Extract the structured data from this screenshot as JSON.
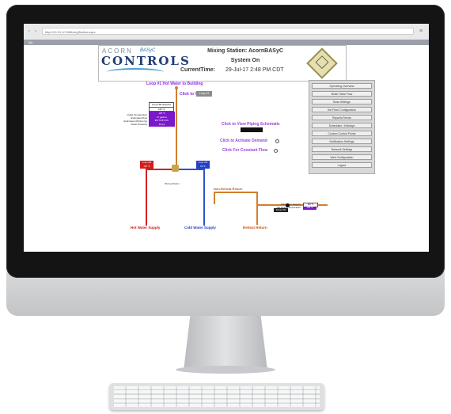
{
  "browser": {
    "address": "http://10.10.10.9/MixingStation.aspx",
    "tab_label": "Tab"
  },
  "header": {
    "logo_acorn": "ACORN",
    "logo_basyc": "BASyC",
    "logo_controls": "CONTROLS",
    "station": "Mixing Station: AcornBASyC",
    "system_status": "System On",
    "current_time_label": "CurrentTime:",
    "current_time_value": "29-Jul-17 2:48 PM CDT"
  },
  "nav": {
    "items": [
      "Operating Overview",
      "Boiler Table Flow",
      "Boss Settings",
      "Set Point Configuration",
      "Reports/Trends",
      "Schedules / Holidays",
      "Custom Control Points",
      "Notification Settings",
      "Network Settings",
      "Web Configuration",
      "Logout"
    ]
  },
  "diagram": {
    "loop_title": "Loop #1 Hot Water to Building",
    "click_to_view": "Click to View",
    "loop_button": "Loop #1",
    "setpoint_label": "Loop HW Setpoint",
    "setpoint_value": "135 °F",
    "stat_labels": [
      "Outlet Temperature",
      "Estimated Flow",
      "Estimated HW Energy",
      "Outlet Pressure"
    ],
    "stat_values": [
      "135 °F",
      "27 gallons",
      "66770 BTU/hr",
      "40 psi"
    ],
    "view_piping": "Click to View Piping Schematic",
    "activate_demand": "Click to Activate Demand",
    "constant_flow": "Click For Constant Flow",
    "hot_in_label": "Loop HW",
    "hot_in_value": "145 °F",
    "cold_in_label": "Loop CW",
    "cold_in_value": "65 °F",
    "mixing_station": "Mixing Station",
    "non_reheat_return": "Non-Reheat Return",
    "reheat_labels": [
      "HW Return Setpoint",
      "HW Return Temperature"
    ],
    "reheat_setpoint": "110 °F",
    "reheat_temp": "106 °F",
    "pump_label": "Pump ON",
    "hot_water_supply": "Hot Water Supply",
    "cold_water_supply": "Cold Water Supply",
    "reheat_return": "Reheat Return"
  }
}
